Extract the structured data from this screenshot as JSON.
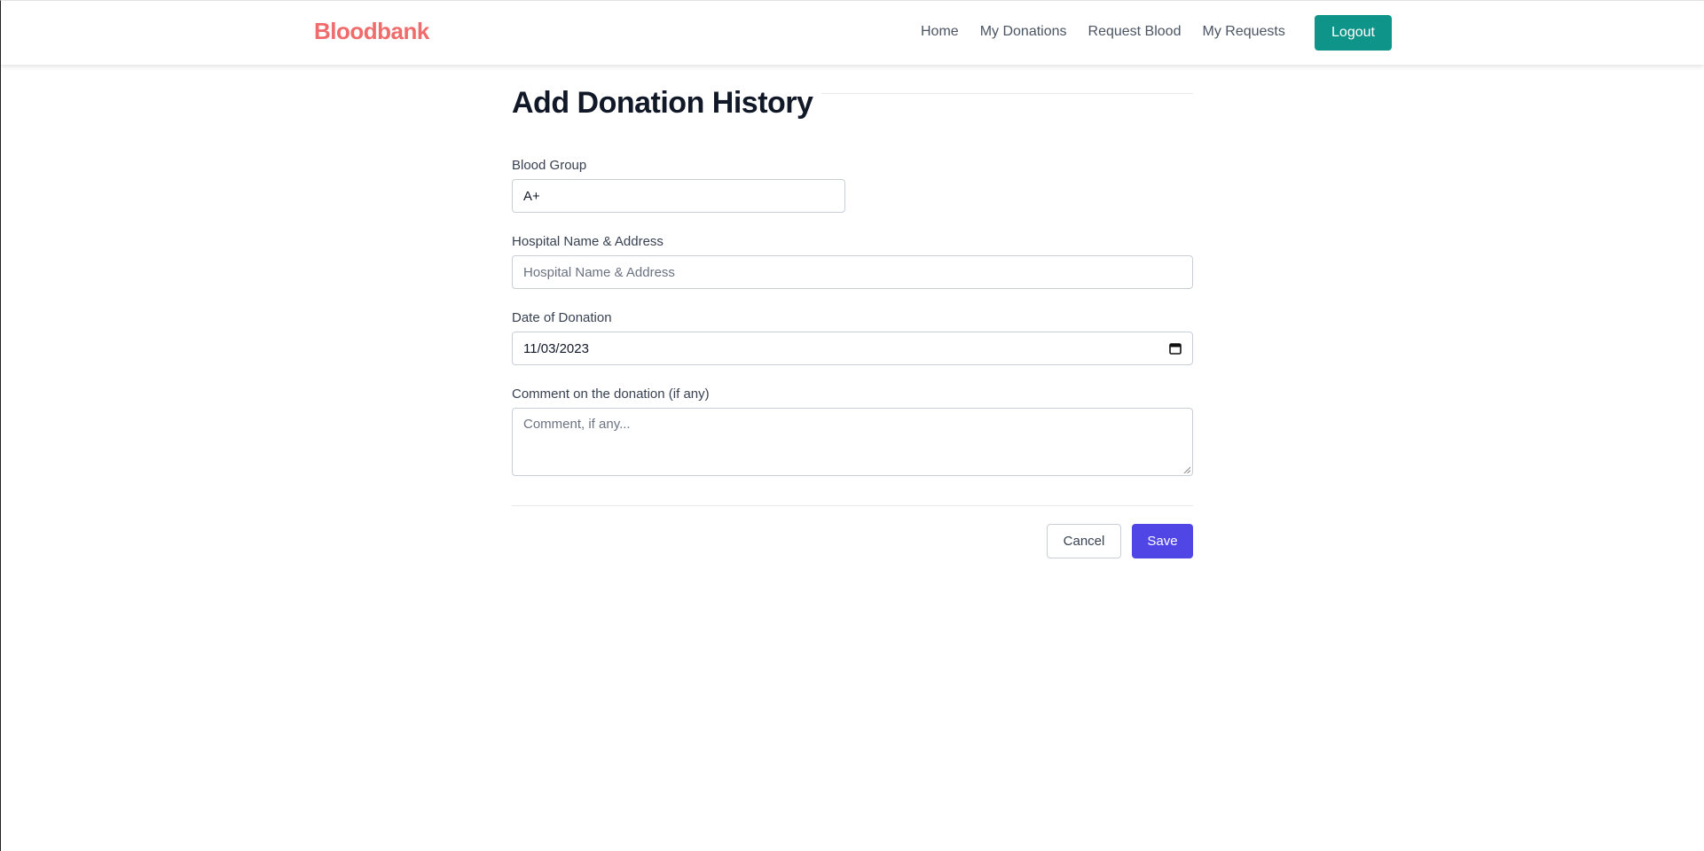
{
  "navbar": {
    "brand": "Bloodbank",
    "links": [
      {
        "label": "Home"
      },
      {
        "label": "My Donations"
      },
      {
        "label": "Request Blood"
      },
      {
        "label": "My Requests"
      }
    ],
    "logout_label": "Logout"
  },
  "form": {
    "title": "Add Donation History",
    "blood_group": {
      "label": "Blood Group",
      "value": "A+"
    },
    "hospital": {
      "label": "Hospital Name & Address",
      "value": "",
      "placeholder": "Hospital Name & Address"
    },
    "date": {
      "label": "Date of Donation",
      "value": "11/03/2023"
    },
    "comment": {
      "label": "Comment on the donation (if any)",
      "value": "",
      "placeholder": "Comment, if any..."
    },
    "cancel_label": "Cancel",
    "save_label": "Save"
  },
  "colors": {
    "brand": "#f06b6b",
    "logout": "#0e9488",
    "save": "#4f46e5"
  }
}
